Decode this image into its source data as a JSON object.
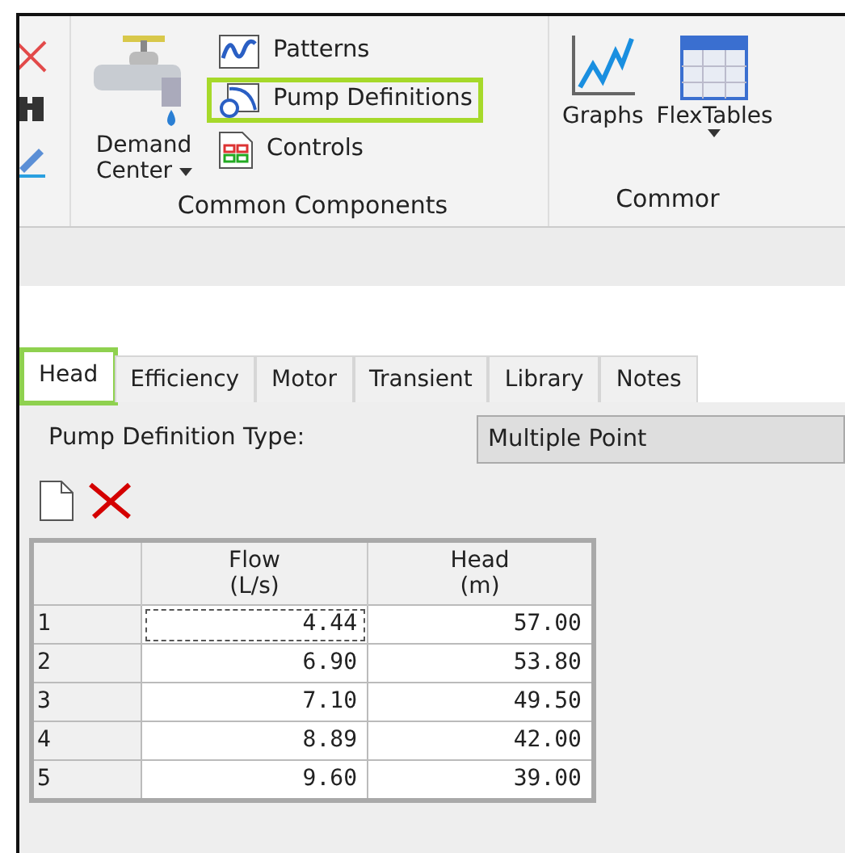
{
  "ribbon": {
    "left_tools": [
      {
        "kind": "delete"
      },
      {
        "kind": "find"
      },
      {
        "kind": "edit"
      }
    ],
    "groups": [
      {
        "title": "Common Components",
        "large": [
          {
            "label": "Demand\nCenter",
            "kind": "tap",
            "dropdown": true
          }
        ],
        "small": [
          {
            "label": "Patterns",
            "kind": "pattern",
            "highlighted": false
          },
          {
            "label": "Pump Definitions",
            "kind": "pump",
            "highlighted": true
          },
          {
            "label": "Controls",
            "kind": "controls",
            "highlighted": false
          }
        ]
      },
      {
        "title": "Commor",
        "large": [
          {
            "label": "Graphs",
            "kind": "graph",
            "dropdown": false
          },
          {
            "label": "FlexTables",
            "kind": "table",
            "dropdown": true
          }
        ]
      }
    ]
  },
  "tabs": [
    {
      "label": "Head",
      "selected": true,
      "highlighted": true
    },
    {
      "label": "Efficiency",
      "selected": false,
      "highlighted": false
    },
    {
      "label": "Motor",
      "selected": false,
      "highlighted": false
    },
    {
      "label": "Transient",
      "selected": false,
      "highlighted": false
    },
    {
      "label": "Library",
      "selected": false,
      "highlighted": false
    },
    {
      "label": "Notes",
      "selected": false,
      "highlighted": false
    }
  ],
  "definition_type": {
    "label": "Pump Definition Type:",
    "value": "Multiple Point"
  },
  "table": {
    "columns": [
      "Flow\n(L/s)",
      "Head\n(m)"
    ],
    "rows": [
      {
        "index": "1",
        "cells": [
          {
            "text": "4.44",
            "focused": true
          },
          {
            "text": "57.00",
            "focused": false
          }
        ]
      },
      {
        "index": "2",
        "cells": [
          {
            "text": "6.90",
            "focused": false
          },
          {
            "text": "53.80",
            "focused": false
          }
        ]
      },
      {
        "index": "3",
        "cells": [
          {
            "text": "7.10",
            "focused": false
          },
          {
            "text": "49.50",
            "focused": false
          }
        ]
      },
      {
        "index": "4",
        "cells": [
          {
            "text": "8.89",
            "focused": false
          },
          {
            "text": "42.00",
            "focused": false
          }
        ]
      },
      {
        "index": "5",
        "cells": [
          {
            "text": "9.60",
            "focused": false
          },
          {
            "text": "39.00",
            "focused": false
          }
        ]
      }
    ]
  }
}
